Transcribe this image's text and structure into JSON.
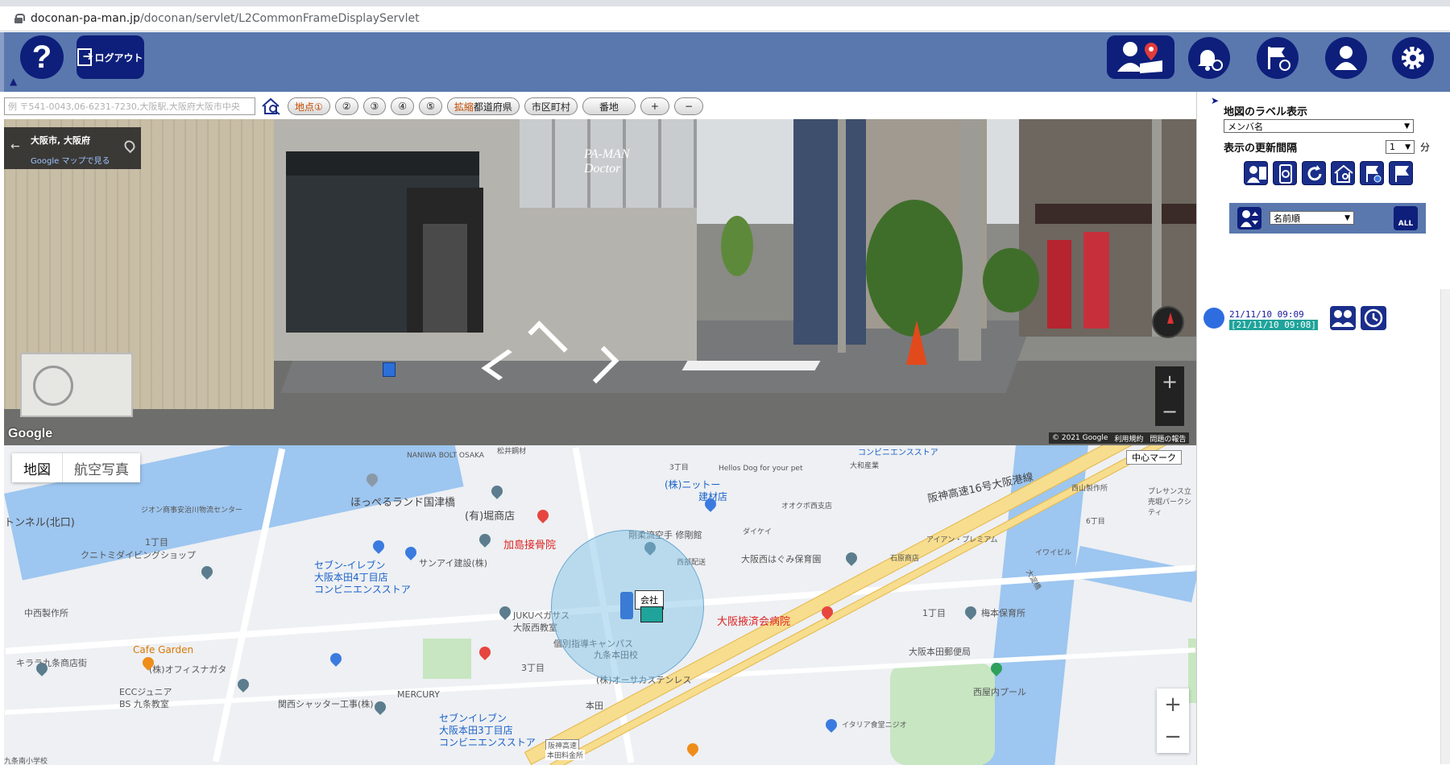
{
  "browser": {
    "url_host": "doconan-pa-man.jp",
    "url_path": "/doconan/servlet/L2CommonFrameDisplayServlet"
  },
  "header": {
    "help_label": "?",
    "logout_label": "ログアウト"
  },
  "toolbar": {
    "search_placeholder": "例 〒541-0043,06-6231-7230,大阪駅,大阪府大阪市中央",
    "point_1": "地点①",
    "point_2": "②",
    "point_3": "③",
    "point_4": "④",
    "point_5": "⑤",
    "expand_prefix": "拡縮",
    "prefecture": "都道府県",
    "city": "市区町村",
    "lot": "番地",
    "zoom_in": "+",
    "zoom_out": "−"
  },
  "street_view": {
    "location_title": "大阪市, 大阪府",
    "gmaps_link": "Google マップで見る",
    "google_logo": "Google",
    "copyright": "© 2021 Google",
    "terms": "利用規約",
    "report": "問題の報告",
    "sign_line1": "PA-MAN",
    "sign_line2": "Doctor"
  },
  "map": {
    "type_map": "地図",
    "type_aerial": "航空写真",
    "center_mark": "中心マーク",
    "company_label": "会社",
    "labels": {
      "naniwa_bolt": "NANIWA BOLT OSAKA",
      "matsui": "松井鋼材",
      "chome3_top": "3丁目",
      "hellos_dog": "Hellos Dog for your pet",
      "conveni": "コンビニエンスストア",
      "yamato": "大和産業",
      "hanshin": "阪神高速16号大阪港線",
      "presence": "プレサンス立売堀パークシティ",
      "nishiyama": "西山製作所",
      "chome6": "6丁目",
      "hoppel": "ほっぺるランド国津橋",
      "horiyu": "(有)堀商店",
      "nitto": "(株)ニットー",
      "nitto_sub": "建材店",
      "oakoku": "オオクボ西支店",
      "tunnel": "トンネル(北口)",
      "zion": "ジオン商事安治川物流センター",
      "kato": "加島接骨院",
      "kaido": "剛柔流空手 修剛館",
      "nishiyama_haisou": "西部配送",
      "daikei": "ダイケイ",
      "irony": "アイアン・プレミアム",
      "iwide": "イワイビル",
      "kuni": "クニトミダイビングショップ",
      "chome1": "1丁目",
      "sevenA": "セブン-イレブン",
      "sevenA2": "大阪本田4丁目店",
      "sevenA3": "コンビニエンスストア",
      "sanai": "サンアイ建設(株)",
      "hagumi": "大阪西はぐみ保育園",
      "ishiwara": "石原商店",
      "osaka_river": "大淀橋",
      "nakanishi": "中西製作所",
      "jukuu": "JUKUペガサス",
      "jukuu2": "大阪西教室",
      "kobetsu": "個別指導キャンパス",
      "kobetsu2": "九条本田校",
      "kyusai": "大阪掖済会病院",
      "chome1b": "1丁目",
      "umemoto": "梅本保育所",
      "cafe": "Cafe Garden",
      "office": "(株)オフィスナガタ",
      "kirara": "キララ九条商店街",
      "ecc": "ECCジュニア",
      "ecc2": "BS 九条教室",
      "kansai": "関西シャッター工事(株)",
      "mercury": "MERCURY",
      "chome3": "3丁目",
      "osaka_steel": "(株)オーサカステンレス",
      "honden_post": "大阪本田郵便局",
      "nishiya": "西屋内プール",
      "sevenB": "セブンイレブン",
      "sevenB2": "大阪本田3丁目店",
      "sevenB3": "コンビニエンスストア",
      "honden": "本田",
      "hanshin_honden": "阪神高速",
      "hanshin_honden2": "本田料金所",
      "italian": "イタリア食堂ニジオ",
      "school": "九条南小学校"
    }
  },
  "right_panel": {
    "label_display": "地図のラベル表示",
    "label_select": "メンバ名",
    "refresh_interval": "表示の更新間隔",
    "refresh_value": "1",
    "refresh_unit": "分",
    "sort_select": "名前順",
    "all_label": "ALL",
    "member": {
      "time1": "21/11/10 09:09",
      "time2": "[21/11/10 09:08]"
    }
  }
}
